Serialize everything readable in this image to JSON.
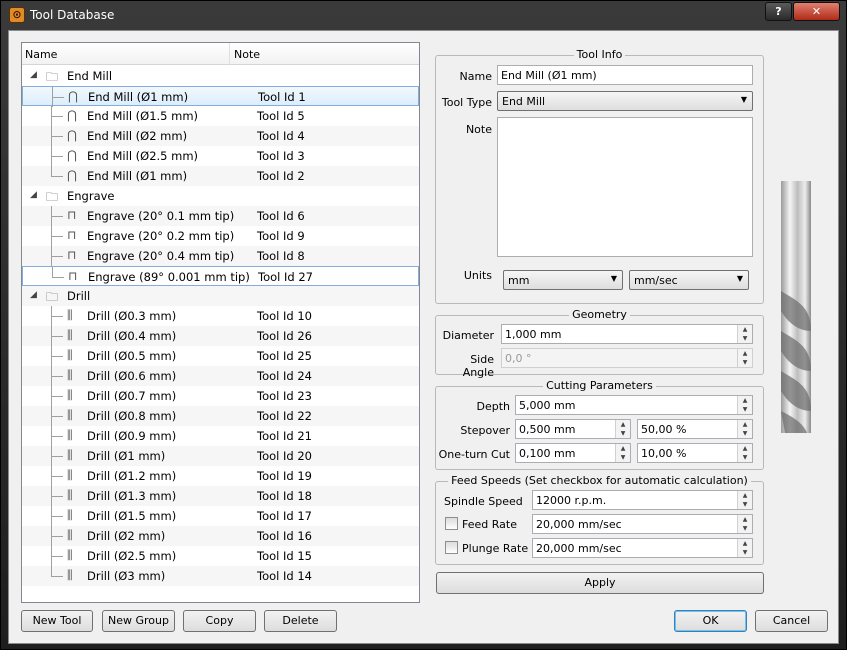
{
  "window": {
    "title": "Tool Database",
    "help_label": "?",
    "close_label": "✕",
    "icon": "app-icon"
  },
  "tree": {
    "columns": [
      "Name",
      "Note"
    ],
    "rows": [
      {
        "type": "group",
        "name": "End Mill",
        "note": ""
      },
      {
        "type": "tool",
        "icon": "endmill-icon",
        "name": "End Mill (Ø1 mm)",
        "note": "Tool Id 1"
      },
      {
        "type": "tool",
        "icon": "endmill-icon",
        "name": "End Mill (Ø1.5 mm)",
        "note": "Tool Id 5"
      },
      {
        "type": "tool",
        "icon": "endmill-icon",
        "name": "End Mill (Ø2 mm)",
        "note": "Tool Id 4"
      },
      {
        "type": "tool",
        "icon": "endmill-icon",
        "name": "End Mill (Ø2.5 mm)",
        "note": "Tool Id 3"
      },
      {
        "type": "tool",
        "icon": "endmill-icon",
        "name": "End Mill (Ø1 mm)",
        "note": "Tool Id 2"
      },
      {
        "type": "group",
        "name": "Engrave",
        "note": ""
      },
      {
        "type": "tool",
        "icon": "engrave-icon",
        "name": "Engrave (20° 0.1 mm tip)",
        "note": "Tool Id 6"
      },
      {
        "type": "tool",
        "icon": "engrave-icon",
        "name": "Engrave (20° 0.2 mm tip)",
        "note": "Tool Id 9"
      },
      {
        "type": "tool",
        "icon": "engrave-icon",
        "name": "Engrave (20° 0.4 mm tip)",
        "note": "Tool Id 8"
      },
      {
        "type": "tool",
        "icon": "engrave-icon",
        "name": "Engrave (89° 0.001 mm tip)",
        "note": "Tool Id 27"
      },
      {
        "type": "group",
        "name": "Drill",
        "note": ""
      },
      {
        "type": "tool",
        "icon": "drill-icon",
        "name": "Drill (Ø0.3 mm)",
        "note": "Tool Id 10"
      },
      {
        "type": "tool",
        "icon": "drill-icon",
        "name": "Drill (Ø0.4 mm)",
        "note": "Tool Id 26"
      },
      {
        "type": "tool",
        "icon": "drill-icon",
        "name": "Drill (Ø0.5 mm)",
        "note": "Tool Id 25"
      },
      {
        "type": "tool",
        "icon": "drill-icon",
        "name": "Drill (Ø0.6 mm)",
        "note": "Tool Id 24"
      },
      {
        "type": "tool",
        "icon": "drill-icon",
        "name": "Drill (Ø0.7 mm)",
        "note": "Tool Id 23"
      },
      {
        "type": "tool",
        "icon": "drill-icon",
        "name": "Drill (Ø0.8 mm)",
        "note": "Tool Id 22"
      },
      {
        "type": "tool",
        "icon": "drill-icon",
        "name": "Drill (Ø0.9 mm)",
        "note": "Tool Id 21"
      },
      {
        "type": "tool",
        "icon": "drill-icon",
        "name": "Drill (Ø1 mm)",
        "note": "Tool Id 20"
      },
      {
        "type": "tool",
        "icon": "drill-icon",
        "name": "Drill (Ø1.2 mm)",
        "note": "Tool Id 19"
      },
      {
        "type": "tool",
        "icon": "drill-icon",
        "name": "Drill (Ø1.3 mm)",
        "note": "Tool Id 18"
      },
      {
        "type": "tool",
        "icon": "drill-icon",
        "name": "Drill (Ø1.5 mm)",
        "note": "Tool Id 17"
      },
      {
        "type": "tool",
        "icon": "drill-icon",
        "name": "Drill (Ø2 mm)",
        "note": "Tool Id 16"
      },
      {
        "type": "tool",
        "icon": "drill-icon",
        "name": "Drill (Ø2.5 mm)",
        "note": "Tool Id 15"
      },
      {
        "type": "tool",
        "icon": "drill-icon",
        "name": "Drill (Ø3 mm)",
        "note": "Tool Id 14"
      }
    ]
  },
  "tool_info": {
    "title": "Tool Info",
    "name_label": "Name",
    "name_value": "End Mill (Ø1 mm)",
    "type_label": "Tool Type",
    "type_value": "End Mill",
    "note_label": "Note",
    "note_value": "",
    "units_label": "Units",
    "units_length": "mm",
    "units_speed": "mm/sec"
  },
  "geometry": {
    "title": "Geometry",
    "diameter_label": "Diameter",
    "diameter_value": "1,000 mm",
    "side_angle_label": "Side Angle",
    "side_angle_value": "0,0 °"
  },
  "cutting": {
    "title": "Cutting Parameters",
    "depth_label": "Depth",
    "depth_value": "5,000 mm",
    "stepover_label": "Stepover",
    "stepover_value": "0,500 mm",
    "stepover_pct": "50,00 %",
    "oneturn_label": "One-turn Cut",
    "oneturn_value": "0,100 mm",
    "oneturn_pct": "10,00 %"
  },
  "feeds": {
    "title": "Feed Speeds (Set checkbox for automatic calculation)",
    "spindle_label": "Spindle Speed",
    "spindle_value": "12000 r.p.m.",
    "feed_label": "Feed Rate",
    "feed_value": "20,000 mm/sec",
    "feed_checked": false,
    "plunge_label": "Plunge Rate",
    "plunge_value": "20,000 mm/sec",
    "plunge_checked": false
  },
  "buttons": {
    "apply": "Apply",
    "new_tool": "New Tool",
    "new_group": "New Group",
    "copy": "Copy",
    "delete": "Delete",
    "ok": "OK",
    "cancel": "Cancel"
  },
  "spin": {
    "up": "▲",
    "down": "▼"
  },
  "combo_arrow": "▼",
  "tree_glyphs": {
    "expanded": "◢",
    "folder": "🗀",
    "endmill": "⋂",
    "engrave": "⊓",
    "drill": "⫼"
  }
}
